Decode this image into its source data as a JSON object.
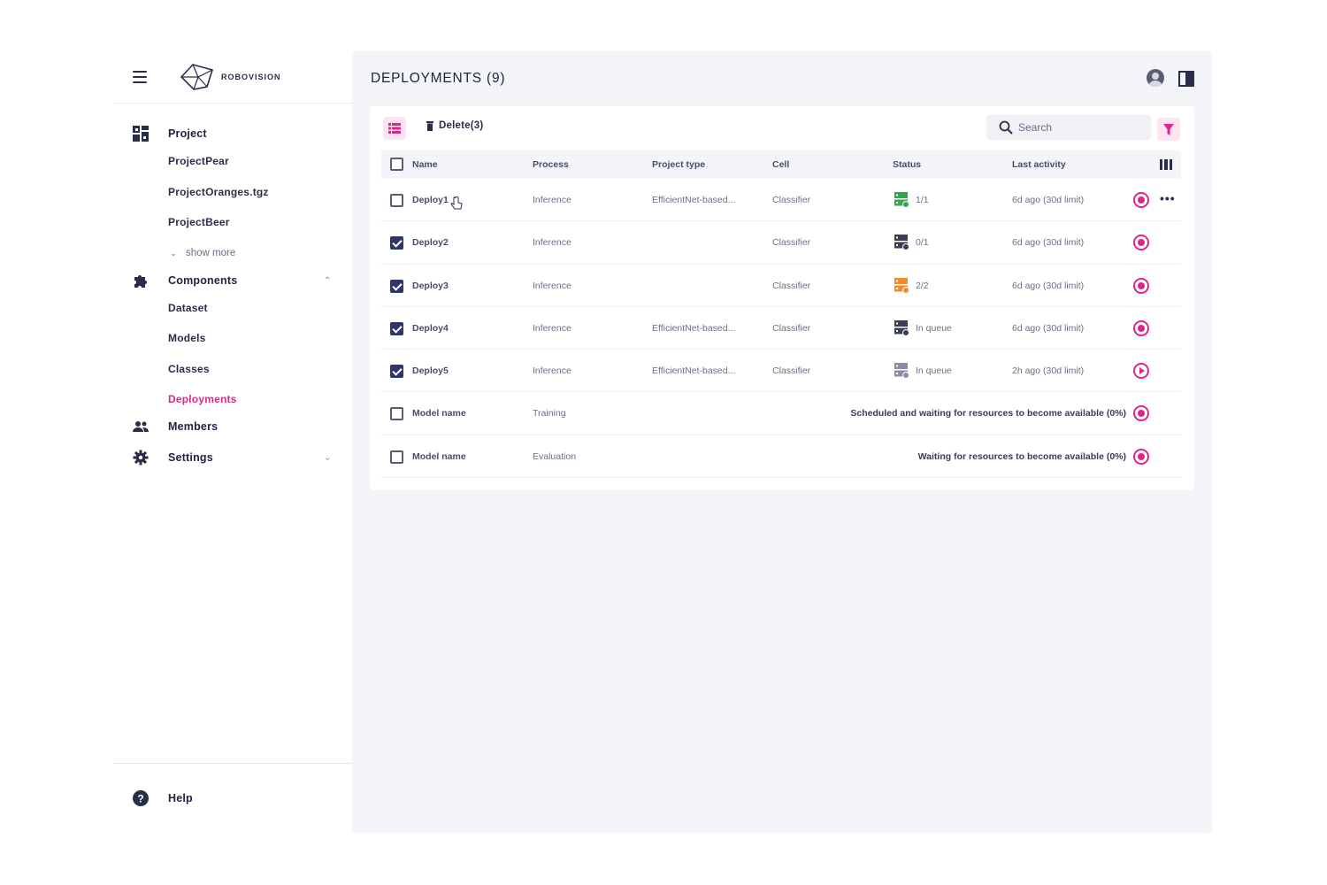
{
  "app": {
    "logo_text": "ROBOVISION"
  },
  "sidebar": {
    "projects_header": "Project",
    "projects": [
      "ProjectPear",
      "ProjectOranges.tgz",
      "ProjectBeer"
    ],
    "show_more": "show more",
    "components_header": "Components",
    "components": [
      "Dataset",
      "Models",
      "Classes",
      "Deployments"
    ],
    "active_item": "Deployments",
    "members": "Members",
    "settings": "Settings",
    "help": "Help"
  },
  "header": {
    "title": "DEPLOYMENTS (9)"
  },
  "toolbar": {
    "delete_label": "Delete(3)",
    "search_placeholder": "Search"
  },
  "table": {
    "columns": [
      "Name",
      "Process",
      "Project type",
      "Cell",
      "Status",
      "Last activity"
    ],
    "rows": [
      {
        "checked": false,
        "name": "Deploy1",
        "process": "Inference",
        "project_type": "EfficientNet-based...",
        "cell": "Classifier",
        "status": "1/1",
        "status_color": "#2fa84f",
        "activity": "6d ago (30d limit)",
        "action": "stop",
        "long_status": ""
      },
      {
        "checked": true,
        "name": "Deploy2",
        "process": "Inference",
        "project_type": "",
        "cell": "Classifier",
        "status": "0/1",
        "status_color": "#3a3d56",
        "activity": "6d ago (30d limit)",
        "action": "stop",
        "long_status": ""
      },
      {
        "checked": true,
        "name": "Deploy3",
        "process": "Inference",
        "project_type": "",
        "cell": "Classifier",
        "status": "2/2",
        "status_color": "#f28c28",
        "activity": "6d ago (30d limit)",
        "action": "stop",
        "long_status": ""
      },
      {
        "checked": true,
        "name": "Deploy4",
        "process": "Inference",
        "project_type": "EfficientNet-based...",
        "cell": "Classifier",
        "status": "In queue",
        "status_color": "#3a3d56",
        "activity": "6d ago (30d limit)",
        "action": "stop",
        "long_status": ""
      },
      {
        "checked": true,
        "name": "Deploy5",
        "process": "Inference",
        "project_type": "EfficientNet-based...",
        "cell": "Classifier",
        "status": "In queue",
        "status_color": "#8a8da3",
        "activity": "2h ago (30d limit)",
        "action": "play",
        "long_status": ""
      },
      {
        "checked": false,
        "name": "Model name",
        "process": "Training",
        "project_type": "",
        "cell": "",
        "status": "",
        "status_color": "",
        "activity": "",
        "action": "stop",
        "long_status": "Scheduled and waiting for resources to become available (0%)"
      },
      {
        "checked": false,
        "name": "Model name",
        "process": "Evaluation",
        "project_type": "",
        "cell": "",
        "status": "",
        "status_color": "",
        "activity": "",
        "action": "stop",
        "long_status": "Waiting for resources to become available (0%)"
      }
    ]
  },
  "colors": {
    "accent": "#e0258a",
    "accent_bg": "#fde4f1",
    "checkbox": "#2c3770",
    "main_bg": "#f4f5f8"
  }
}
